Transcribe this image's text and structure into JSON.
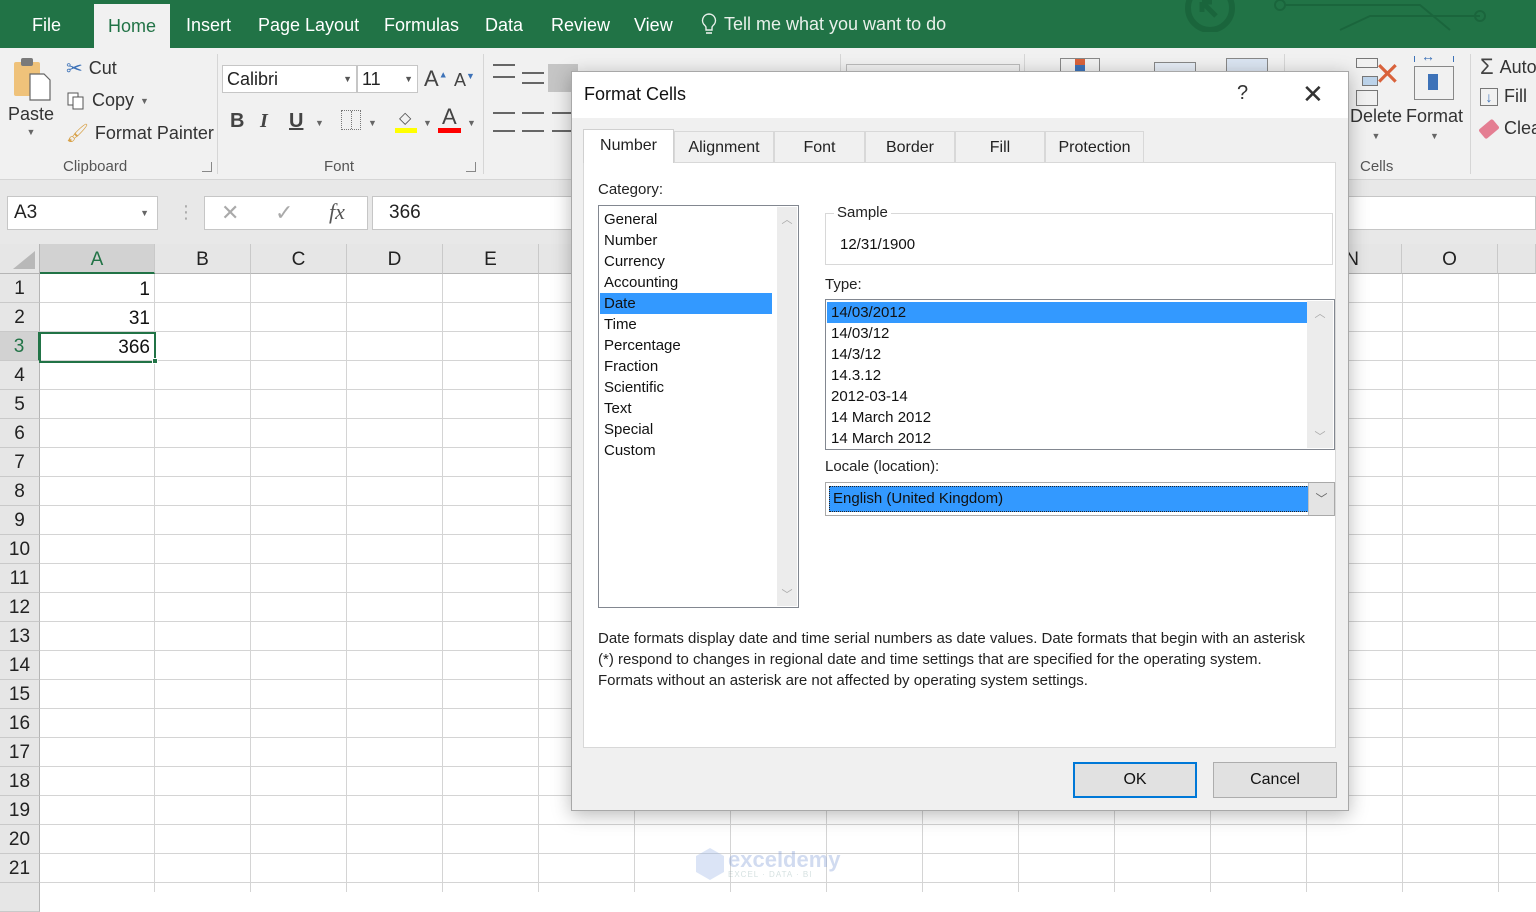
{
  "ribbon_tabs": [
    {
      "label": "File",
      "active": false
    },
    {
      "label": "Home",
      "active": true
    },
    {
      "label": "Insert",
      "active": false
    },
    {
      "label": "Page Layout",
      "active": false
    },
    {
      "label": "Formulas",
      "active": false
    },
    {
      "label": "Data",
      "active": false
    },
    {
      "label": "Review",
      "active": false
    },
    {
      "label": "View",
      "active": false
    }
  ],
  "tell_me": {
    "icon": "lightbulb-icon",
    "label": "Tell me what you want to do"
  },
  "clipboard": {
    "paste": "Paste",
    "cut": "Cut",
    "copy": "Copy",
    "format_painter": "Format Painter",
    "group_label": "Clipboard"
  },
  "font": {
    "name": "Calibri",
    "size": "11",
    "bold": "B",
    "italic": "I",
    "underline": "U",
    "grow": "A",
    "shrink": "A",
    "font_color_glyph": "A",
    "group_label": "Font",
    "highlight_color": "#ffff00",
    "font_color": "#ff0000"
  },
  "cells_group": {
    "delete": "Delete",
    "format": "Format",
    "group_label": "Cells"
  },
  "editing_group": {
    "autosum": "Auto",
    "fill": "Fill",
    "clear": "Clea"
  },
  "formula_bar": {
    "name_box": "A3",
    "cancel_glyph": "✕",
    "enter_glyph": "✓",
    "fx_glyph": "fx",
    "value": "366"
  },
  "grid": {
    "columns": [
      "A",
      "B",
      "C",
      "D",
      "E",
      "N",
      "O"
    ],
    "rows": [
      "1",
      "2",
      "3",
      "4",
      "5",
      "6",
      "7",
      "8",
      "9",
      "10",
      "11",
      "12",
      "13",
      "14",
      "15",
      "16",
      "17",
      "18",
      "19",
      "20",
      "21"
    ],
    "selected_cell": "A3",
    "cells": [
      {
        "ref": "A1",
        "value": "1"
      },
      {
        "ref": "A2",
        "value": "31"
      },
      {
        "ref": "A3",
        "value": "366"
      }
    ]
  },
  "watermark": {
    "text": "exceldemy",
    "sub": "EXCEL · DATA · BI"
  },
  "dialog": {
    "title": "Format Cells",
    "help": "?",
    "close": "✕",
    "tabs": [
      {
        "label": "Number",
        "active": true
      },
      {
        "label": "Alignment",
        "active": false
      },
      {
        "label": "Font",
        "active": false
      },
      {
        "label": "Border",
        "active": false
      },
      {
        "label": "Fill",
        "active": false
      },
      {
        "label": "Protection",
        "active": false
      }
    ],
    "category_label": "Category:",
    "categories": [
      "General",
      "Number",
      "Currency",
      "Accounting",
      "Date",
      "Time",
      "Percentage",
      "Fraction",
      "Scientific",
      "Text",
      "Special",
      "Custom"
    ],
    "selected_category": "Date",
    "sample_label": "Sample",
    "sample_value": "12/31/1900",
    "type_label": "Type:",
    "types": [
      "14/03/2012",
      "14/03/12",
      "14/3/12",
      "14.3.12",
      "2012-03-14",
      "14 March 2012",
      "14 March 2012"
    ],
    "selected_type": "14/03/2012",
    "locale_label": "Locale (location):",
    "locale_value": "English (United Kingdom)",
    "description": "Date formats display date and time serial numbers as date values.  Date formats that begin with an asterisk (*) respond to changes in regional date and time settings that are specified for the operating system. Formats without an asterisk are not affected by operating system settings.",
    "ok": "OK",
    "cancel": "Cancel"
  },
  "colors": {
    "excel_green": "#217346",
    "selection_blue": "#3399ff",
    "default_button_border": "#0078d7"
  }
}
